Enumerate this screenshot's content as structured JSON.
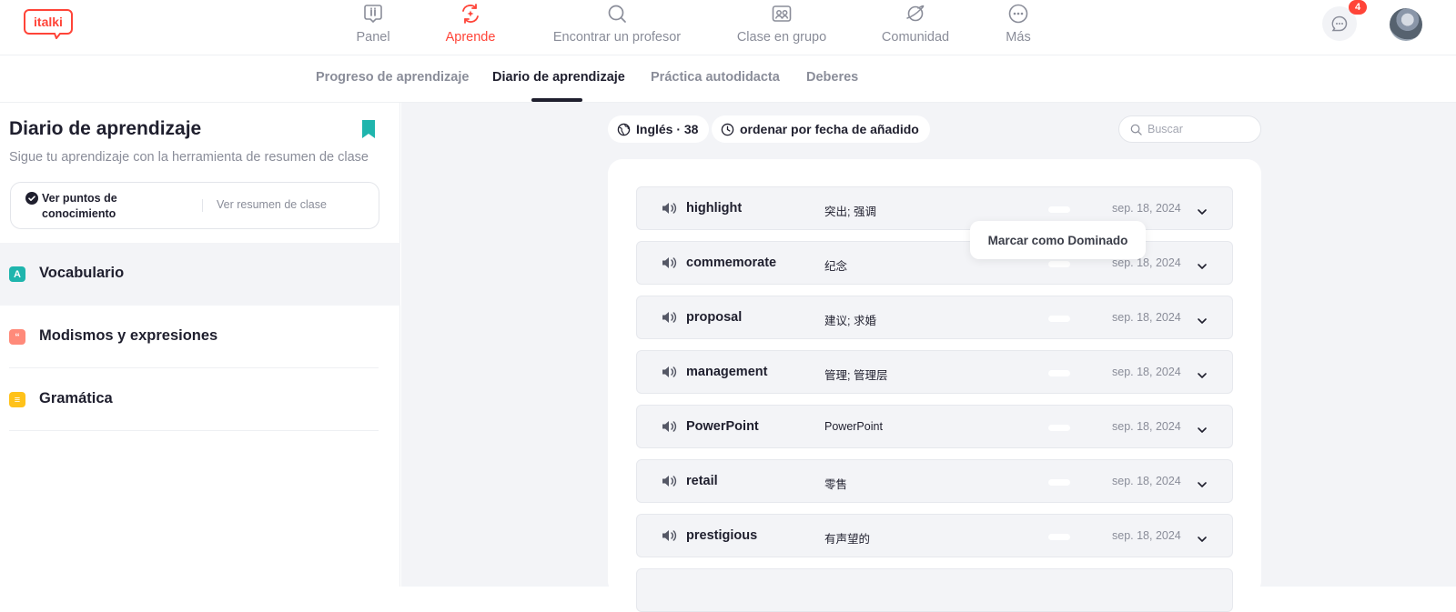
{
  "app": {
    "logo_text": "italki"
  },
  "nav": [
    {
      "label": "Panel",
      "icon": "dashboard-icon"
    },
    {
      "label": "Aprende",
      "icon": "learn-icon",
      "active": true
    },
    {
      "label": "Encontrar un profesor",
      "icon": "search-icon"
    },
    {
      "label": "Clase en grupo",
      "icon": "group-class-icon"
    },
    {
      "label": "Comunidad",
      "icon": "community-icon"
    },
    {
      "label": "Más",
      "icon": "more-icon"
    }
  ],
  "header": {
    "messages_badge": "4"
  },
  "subtabs": [
    {
      "label": "Progreso de aprendizaje"
    },
    {
      "label": "Diario de aprendizaje",
      "active": true
    },
    {
      "label": "Práctica autodidacta"
    },
    {
      "label": "Deberes"
    }
  ],
  "sidebar": {
    "title": "Diario de aprendizaje",
    "subtitle": "Sigue tu aprendizaje con la herramienta de resumen de clase",
    "toggle_a": "Ver puntos de conocimiento",
    "toggle_b": "Ver resumen de clase",
    "categories": [
      {
        "label": "Vocabulario",
        "badge": "A",
        "color": "#1fb5ad",
        "active": true
      },
      {
        "label": "Modismos y expresiones",
        "badge": "“",
        "color": "#ff8a7a"
      },
      {
        "label": "Gramática",
        "badge": "≡",
        "color": "#ffc21a"
      }
    ]
  },
  "main": {
    "language_filter": "Inglés · 38",
    "sort_label": "ordenar por fecha de añadido",
    "search_placeholder": "Buscar",
    "tooltip": "Marcar como Dominado",
    "words": [
      {
        "word": "highlight",
        "translation": "突出; 强调",
        "date": "sep. 18, 2024"
      },
      {
        "word": "commemorate",
        "translation": "纪念",
        "date": "sep. 18, 2024"
      },
      {
        "word": "proposal",
        "translation": "建议; 求婚",
        "date": "sep. 18, 2024"
      },
      {
        "word": "management",
        "translation": "管理; 管理层",
        "date": "sep. 18, 2024"
      },
      {
        "word": "PowerPoint",
        "translation": "PowerPoint",
        "date": "sep. 18, 2024"
      },
      {
        "word": "retail",
        "translation": "零售",
        "date": "sep. 18, 2024"
      },
      {
        "word": "prestigious",
        "translation": "有声望的",
        "date": "sep. 18, 2024"
      }
    ]
  },
  "colors": {
    "accent": "#ff4438",
    "teal": "#1fb5ad",
    "bg": "#f3f4f7"
  }
}
